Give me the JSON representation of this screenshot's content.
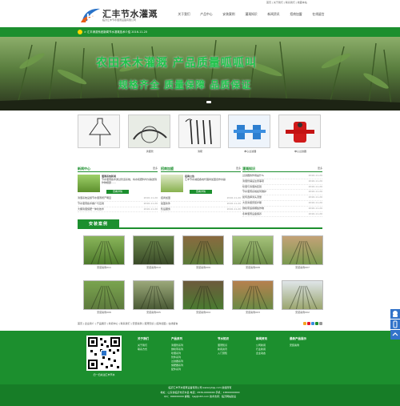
{
  "header": {
    "brand_name": "汇丰节水灌溉",
    "brand_sub": "临沂汇丰节水灌溉设备有限公司",
    "top_links": "首页 | 关于我们 | 联系我们 | 收藏本站",
    "nav": [
      "关于我们",
      "产品中心",
      "安装案例",
      "灌溉知识",
      "新闻资讯",
      "招商加盟",
      "在线留言"
    ]
  },
  "ticker": {
    "text": "> 汇丰滴灌系统新闻节水灌溉技术介绍 2016-11-20"
  },
  "banner": {
    "line1": "农田禾木灌溉  产品质量呱呱叫",
    "line2": "规格齐全  质量保障  品质保证"
  },
  "products": [
    {
      "caption": ""
    },
    {
      "caption": "滴灌管"
    },
    {
      "caption": "滴箭"
    },
    {
      "caption": "单心过滤器"
    },
    {
      "caption": "单心过滤器"
    }
  ],
  "news": {
    "title": "新闻中心",
    "more": "更多",
    "feature_title": "灌溉系统新闻",
    "feature_text": "节水灌溉技术通过管道系统，将水和肥料均匀输送到作物根部……",
    "feature_btn": "查看详情",
    "items": [
      {
        "t": "滴灌系统设施节水灌溉增产明显",
        "d": "2016-11-20"
      },
      {
        "t": "节水灌溉技术推广与应用",
        "d": "2016-11-20"
      },
      {
        "t": "大棚滴灌施肥一体化技术",
        "d": "2016-11-20"
      }
    ]
  },
  "cases": {
    "title": "招商加盟",
    "more": "更多",
    "feature_title": "招商公告",
    "feature_text": "汇丰节水诚招各地代理商加盟合作共赢",
    "feature_btn": "查看详情",
    "items": [
      {
        "t": "招商加盟",
        "d": "2016-11-20"
      },
      {
        "t": "加盟条件",
        "d": "2016-11-20"
      },
      {
        "t": "售后服务",
        "d": "2016-11-20"
      }
    ]
  },
  "faq": {
    "title": "灌溉知识",
    "more": "更多",
    "items": [
      {
        "t": "过滤器的作用是什么",
        "d": "2016-11-20"
      },
      {
        "t": "滴灌管铺设注意事项",
        "d": "2016-11-20"
      },
      {
        "t": "喷灌与滴灌的区别",
        "d": "2016-11-20"
      },
      {
        "t": "节水灌溉系统如何维护",
        "d": "2016-11-20"
      },
      {
        "t": "如何选择滴头流量",
        "d": "2016-11-20"
      },
      {
        "t": "大田滴灌安装步骤",
        "d": "2016-11-20"
      },
      {
        "t": "微喷带适用哪些作物",
        "d": "2016-11-20"
      },
      {
        "t": "冬季灌溉设备保养",
        "d": "2016-11-20"
      }
    ]
  },
  "install": {
    "title": "安装案例",
    "items": [
      "安装案例011",
      "安装案例010",
      "安装案例009",
      "安装案例008",
      "安装案例007",
      "安装案例006",
      "安装案例005",
      "安装案例004",
      "安装案例003",
      "安装案例002"
    ]
  },
  "linkbar": "首页 | 企业简介 | 产品展示 | 新闻中心 | 联系我们 | 安装案例 | 灌溉知识 | 招商加盟 | 在线留言",
  "footer": {
    "qr_caption": "扫一扫关注汇丰节水",
    "cols": [
      {
        "h": "关于我们",
        "items": [
          "关于我们",
          "联系方式"
        ]
      },
      {
        "h": "产品系列",
        "items": [
          "滴灌管系列",
          "微喷带系列",
          "喷灌系列",
          "管件系列",
          "过滤器系列",
          "施肥器系列",
          "配件系列"
        ]
      },
      {
        "h": "节水知识",
        "items": [
          "灌溉知识",
          "新闻资讯",
          "入门须知"
        ]
      },
      {
        "h": "新闻资讯",
        "items": [
          "公司新闻",
          "行业新闻",
          "企业动态"
        ]
      },
      {
        "h": "最新产品展示",
        "items": [
          "安装案例"
        ]
      }
    ],
    "copy_lines": [
      "临沂汇丰节水灌溉设备有限公司 www.lyhjsj.com 版权所有",
      "地址：山东省临沂市沂水县 电话：0539-0000000 手机：13800000000",
      "QQ：000000000 邮箱：hjsj@163.com 技术支持：临沂网站建设"
    ]
  },
  "colors": {
    "green": "#1c8f2e",
    "banner_text": "#1fc34a"
  }
}
